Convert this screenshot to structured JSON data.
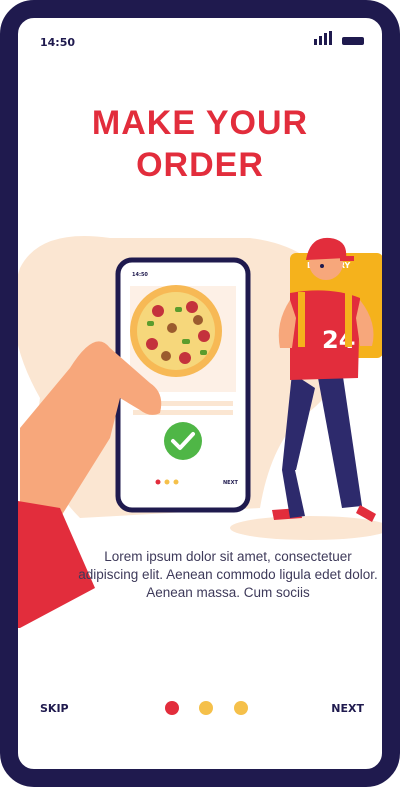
{
  "status_bar": {
    "time": "14:50",
    "signal_icon": "signal-bars-icon",
    "battery_icon": "battery-icon"
  },
  "title": {
    "line1": "MAKE YOUR",
    "line2": "ORDER"
  },
  "illustration": {
    "phone_time": "14:50",
    "phone_next_label": "NEXT",
    "bag_label": "DELIVERY",
    "check_icon": "check-icon"
  },
  "description": "Lorem ipsum dolor sit amet, consectetuer adipiscing elit. Aenean commodo ligula edet dolor. Aenean massa. Cum sociis",
  "nav": {
    "skip_label": "SKIP",
    "next_label": "NEXT",
    "dots": [
      "active",
      "inactive",
      "inactive"
    ]
  },
  "colors": {
    "frame": "#1f1a4e",
    "accent": "#e22d3c",
    "dot_inactive": "#f5c04a",
    "blob": "#fbe6d2"
  }
}
